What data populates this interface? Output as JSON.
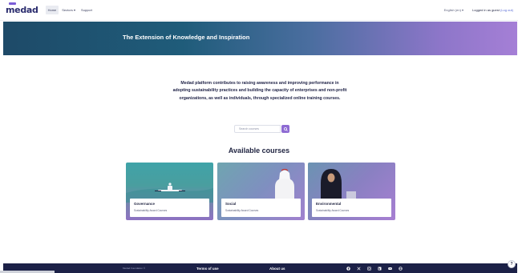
{
  "brand": {
    "logo": "medad",
    "accent": "#8e6bd3",
    "dark": "#1c2147"
  },
  "nav": {
    "items": [
      {
        "label": "Home",
        "active": true
      },
      {
        "label": "Sectors",
        "chevron": true
      },
      {
        "label": "Support"
      }
    ],
    "language": "English (en)",
    "login_text": "Logged in as guest",
    "logout_text": "(Log out)"
  },
  "hero": {
    "title": "The Extension of Knowledge and Inspiration"
  },
  "intro": {
    "text": "Medad platform contributes to raising awareness and improving performance in adopting sustainability practices and building the capacity of enterprises and non-profit organizations, as well as individuals, through specialized online training courses."
  },
  "search": {
    "placeholder": "Search courses",
    "icon": "search-icon"
  },
  "courses": {
    "heading": "Available courses",
    "items": [
      {
        "name": "Governance",
        "category": "Sustainability Award Courses"
      },
      {
        "name": "Social",
        "category": "Sustainability Award Courses"
      },
      {
        "name": "Environmental",
        "category": "Sustainability Award Courses"
      }
    ]
  },
  "footer": {
    "copyright": "Medad Foundation ©",
    "links": [
      "Terms of use",
      "About us"
    ],
    "social_icons": [
      "facebook-icon",
      "x-icon",
      "instagram-icon",
      "linkedin-icon",
      "youtube-icon",
      "website-icon"
    ]
  },
  "help": {
    "label": "?"
  }
}
